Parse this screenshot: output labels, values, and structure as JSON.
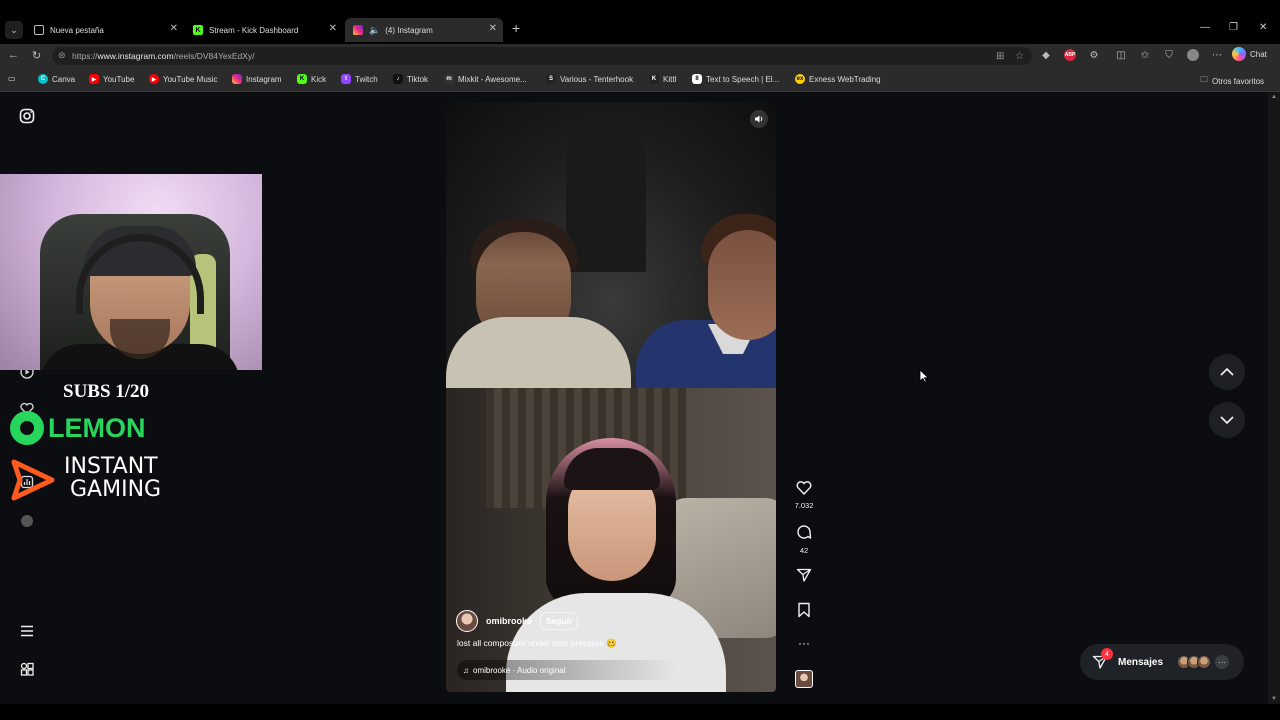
{
  "browser": {
    "tabs": [
      {
        "title": "Nueva pestaña",
        "icon": "new-tab-icon"
      },
      {
        "title": "Stream - Kick Dashboard",
        "icon": "kick-icon"
      },
      {
        "title": "(4) Instagram",
        "icon": "instagram-icon",
        "active": true
      }
    ],
    "url_prefix": "https://",
    "url_host": "www.instagram.com",
    "url_path": "/reels/DV84YexEdXy/",
    "chat_label": "Chat",
    "bookmarks": [
      {
        "label": "Canva",
        "color": "#00c4cc"
      },
      {
        "label": "YouTube",
        "color": "#ff0000"
      },
      {
        "label": "YouTube Music",
        "color": "#ff0000"
      },
      {
        "label": "Instagram",
        "color": "#d6249f"
      },
      {
        "label": "Kick",
        "color": "#53fc18"
      },
      {
        "label": "Twitch",
        "color": "#9146ff"
      },
      {
        "label": "Tiktok",
        "color": "#111111"
      },
      {
        "label": "Mixkit - Awesome...",
        "color": "#333333"
      },
      {
        "label": "Various - Tenterhook",
        "color": "#222222"
      },
      {
        "label": "Kittl",
        "color": "#222222"
      },
      {
        "label": "Text to Speech | El...",
        "color": "#ffffff"
      },
      {
        "label": "Exness WebTrading",
        "color": "#ffd000"
      }
    ],
    "other_favorites": "Otros favoritos"
  },
  "overlay": {
    "subs": "SUBS 1/20",
    "lemon": "LEMON",
    "instant_line1": "INSTANT",
    "instant_line2": "GAMING",
    "lemon_color": "#27d65c",
    "instant_color": "#ff5b1f"
  },
  "reel": {
    "username": "omibrooke",
    "follow_label": "Seguir",
    "caption": "lost all composure under zero pressure 🥴",
    "audio": "omibrooke · Audio original",
    "likes": "7.032",
    "comments": "42"
  },
  "messages": {
    "label": "Mensajes",
    "badge": "4"
  }
}
